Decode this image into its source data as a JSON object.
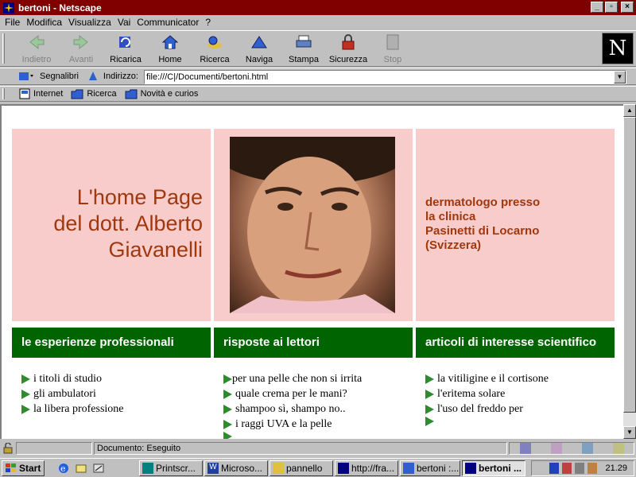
{
  "window": {
    "title": "bertoni - Netscape"
  },
  "menu": [
    "File",
    "Modifica",
    "Visualizza",
    "Vai",
    "Communicator",
    "?"
  ],
  "toolbar": [
    {
      "label": "Indietro",
      "icon": "back-arrow-icon",
      "disabled": true
    },
    {
      "label": "Avanti",
      "icon": "forward-arrow-icon",
      "disabled": true
    },
    {
      "label": "Ricarica",
      "icon": "reload-icon",
      "disabled": false
    },
    {
      "label": "Home",
      "icon": "home-icon",
      "disabled": false
    },
    {
      "label": "Ricerca",
      "icon": "search-icon",
      "disabled": false
    },
    {
      "label": "Naviga",
      "icon": "navigate-icon",
      "disabled": false
    },
    {
      "label": "Stampa",
      "icon": "print-icon",
      "disabled": false
    },
    {
      "label": "Sicurezza",
      "icon": "lock-icon",
      "disabled": false
    },
    {
      "label": "Stop",
      "icon": "stop-icon",
      "disabled": true
    }
  ],
  "location": {
    "bookmarks_label": "Segnalibri",
    "address_label": "Indirizzo:",
    "url": "file:///C|/Documenti/bertoni.html"
  },
  "links": [
    "Internet",
    "Ricerca",
    "Novità e curios"
  ],
  "page": {
    "heading_lines": [
      "L'home Page",
      "del dott. Alberto",
      "Giavanelli"
    ],
    "role_lines": [
      "dermatologo presso",
      "la clinica",
      "Pasinetti di Locarno",
      "(Svizzera)"
    ],
    "sections": [
      {
        "title": "le esperienze professionali",
        "items": [
          "i titoli di studio",
          "gli ambulatori",
          "la libera professione"
        ]
      },
      {
        "title": "risposte ai lettori",
        "items": [
          "per una pelle che non si irrita",
          "quale crema per le mani?",
          "shampoo sì, shampo no..",
          "i raggi UVA e la pelle",
          ""
        ]
      },
      {
        "title": "articoli di interesse scientifico",
        "items": [
          "la vitiligine e il cortisone",
          "l'eritema solare",
          "l'uso del freddo per",
          ""
        ]
      }
    ]
  },
  "status": {
    "text": "Documento: Eseguito"
  },
  "taskbar": {
    "start_label": "Start",
    "tasks": [
      "Printscr...",
      "Microso...",
      "pannello",
      "http://fra...",
      "bertoni :...",
      "bertoni ..."
    ],
    "clock": "21.29"
  },
  "colors": {
    "title_bg": "#800000",
    "cell_pink": "#f9cccc",
    "bar_green": "#006400",
    "heading_text": "#a0380e"
  }
}
